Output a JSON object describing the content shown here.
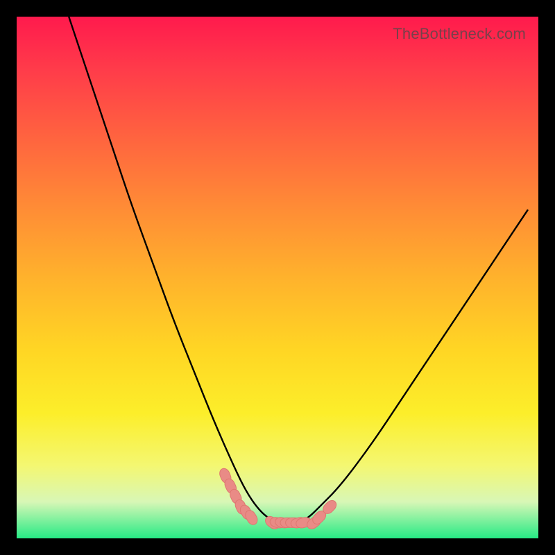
{
  "watermark": "TheBottleneck.com",
  "chart_data": {
    "type": "line",
    "title": "",
    "xlabel": "",
    "ylabel": "",
    "xlim": [
      0,
      100
    ],
    "ylim": [
      0,
      100
    ],
    "series": [
      {
        "name": "bottleneck-curve",
        "x": [
          10,
          14,
          18,
          22,
          26,
          30,
          34,
          38,
          42,
          44,
          46,
          48,
          50,
          52,
          54,
          56,
          58,
          62,
          68,
          74,
          80,
          86,
          92,
          98
        ],
        "y": [
          100,
          88,
          76,
          64,
          53,
          42,
          32,
          22,
          13,
          9,
          6,
          4,
          3,
          3,
          3,
          4,
          6,
          10,
          18,
          27,
          36,
          45,
          54,
          63
        ]
      },
      {
        "name": "sweet-spot-markers",
        "x": [
          40,
          41,
          42,
          43,
          44,
          45,
          49,
          50,
          51,
          52,
          53,
          54,
          55,
          57,
          58,
          60
        ],
        "y": [
          12,
          10,
          8,
          6,
          5,
          4,
          3,
          3,
          3,
          3,
          3,
          3,
          3,
          3,
          4,
          6
        ]
      }
    ],
    "annotations": []
  },
  "colors": {
    "curve": "#000000",
    "marker_fill": "#e98b86",
    "marker_stroke": "#de7770"
  }
}
